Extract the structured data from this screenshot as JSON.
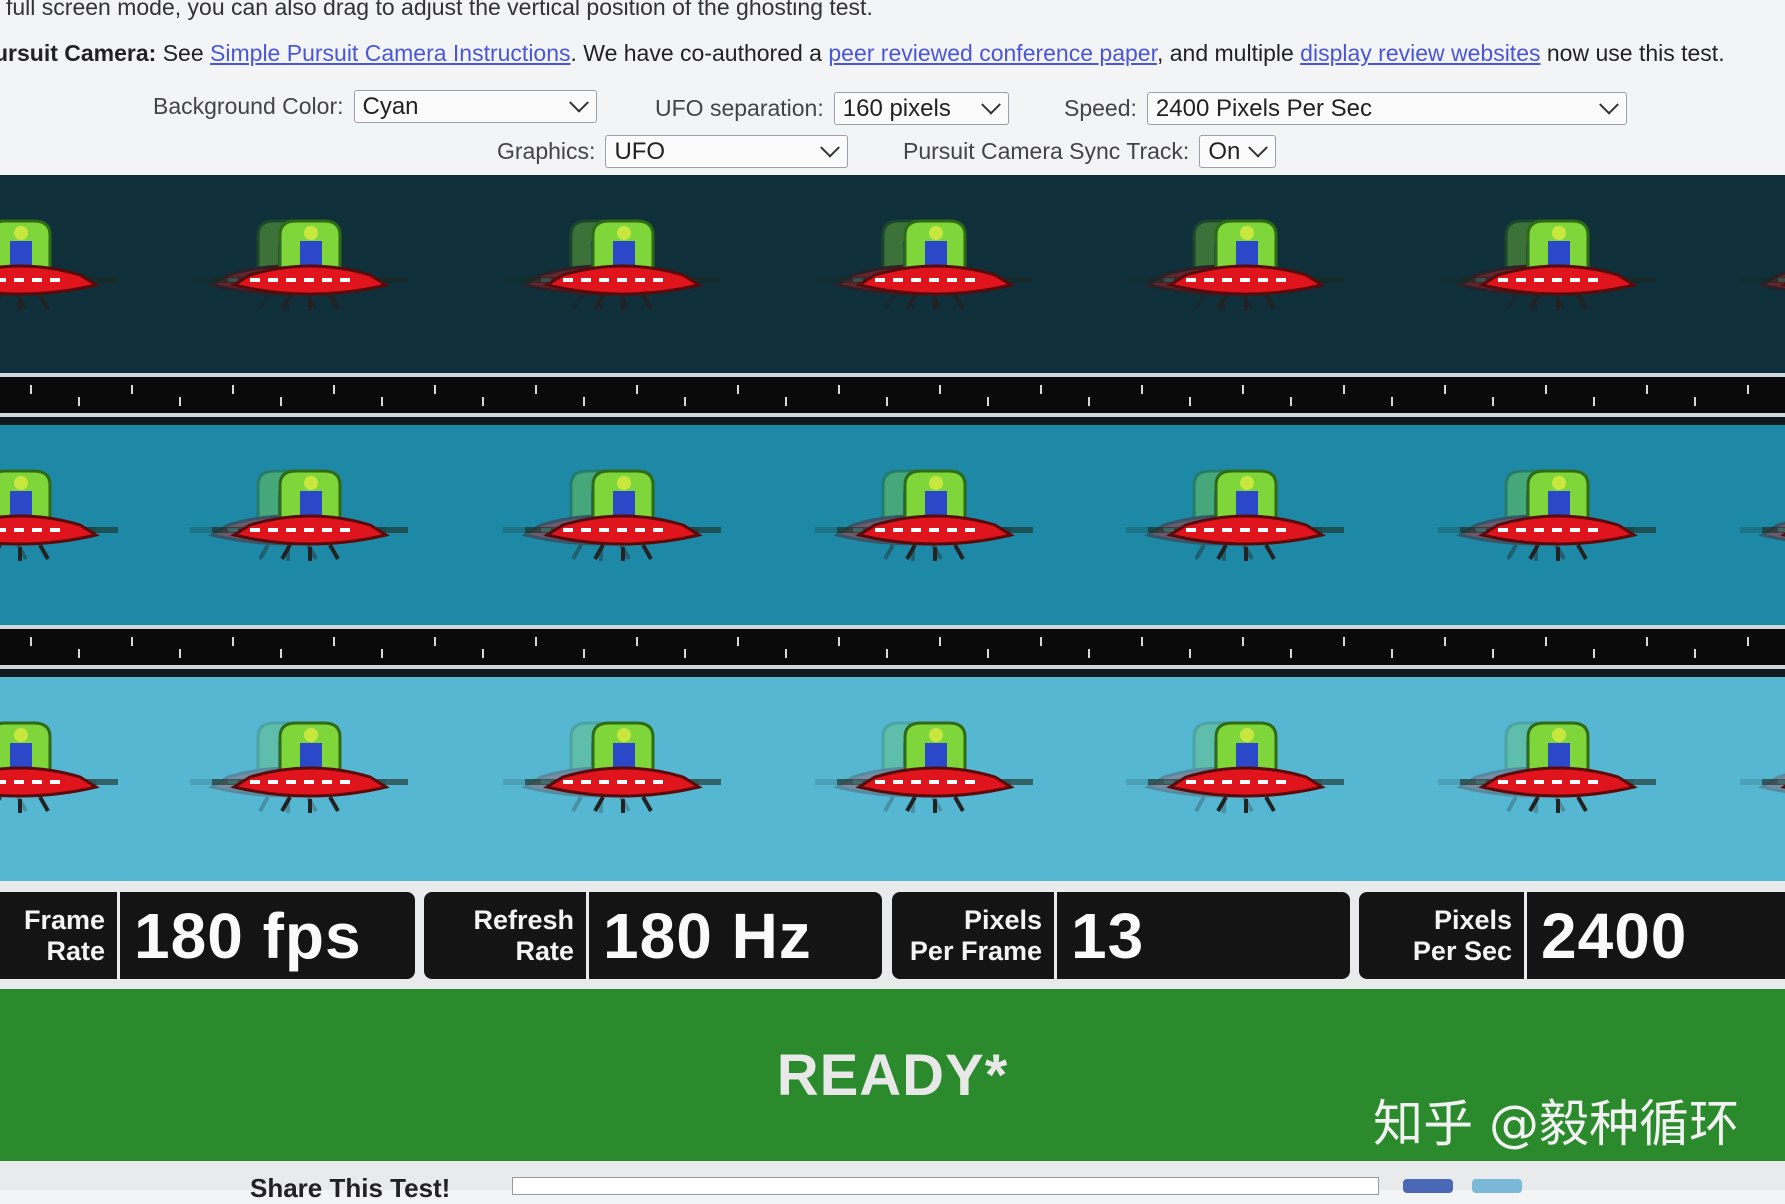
{
  "intro_text": "full screen mode, you can also drag to adjust the vertical position of the ghosting test.",
  "camera": {
    "label": "ursuit Camera:",
    "t1": " See ",
    "link1": "Simple Pursuit Camera Instructions",
    "t2": ". We have co-authored a ",
    "link2": "peer reviewed conference paper",
    "t3": ", and multiple ",
    "link3": "display review websites",
    "t4": " now use this test."
  },
  "controls": {
    "background_label": "Background Color:",
    "background_value": "Cyan",
    "separation_label": "UFO separation:",
    "separation_value": "160 pixels",
    "speed_label": "Speed:",
    "speed_value": "2400 Pixels Per Sec",
    "graphics_label": "Graphics:",
    "graphics_value": "UFO",
    "sync_label": "Pursuit Camera Sync Track:",
    "sync_value": "On"
  },
  "lanes": [
    {
      "color": "#0f2f3a"
    },
    {
      "color": "#1e89a6"
    },
    {
      "color": "#55b7d2"
    }
  ],
  "stats": [
    {
      "key1": "Frame",
      "key2": "Rate",
      "value": "180 fps"
    },
    {
      "key1": "Refresh",
      "key2": "Rate",
      "value": "180 Hz"
    },
    {
      "key1": "Pixels",
      "key2": "Per Frame",
      "value": "13"
    },
    {
      "key1": "Pixels",
      "key2": "Per Sec",
      "value": "2400"
    }
  ],
  "status_text": "READY*",
  "watermark": "知乎 @毅种循环",
  "footer_text": "Share This Test!",
  "colors": {
    "ready_green": "#2a8a2c",
    "link": "#4a56d8"
  }
}
